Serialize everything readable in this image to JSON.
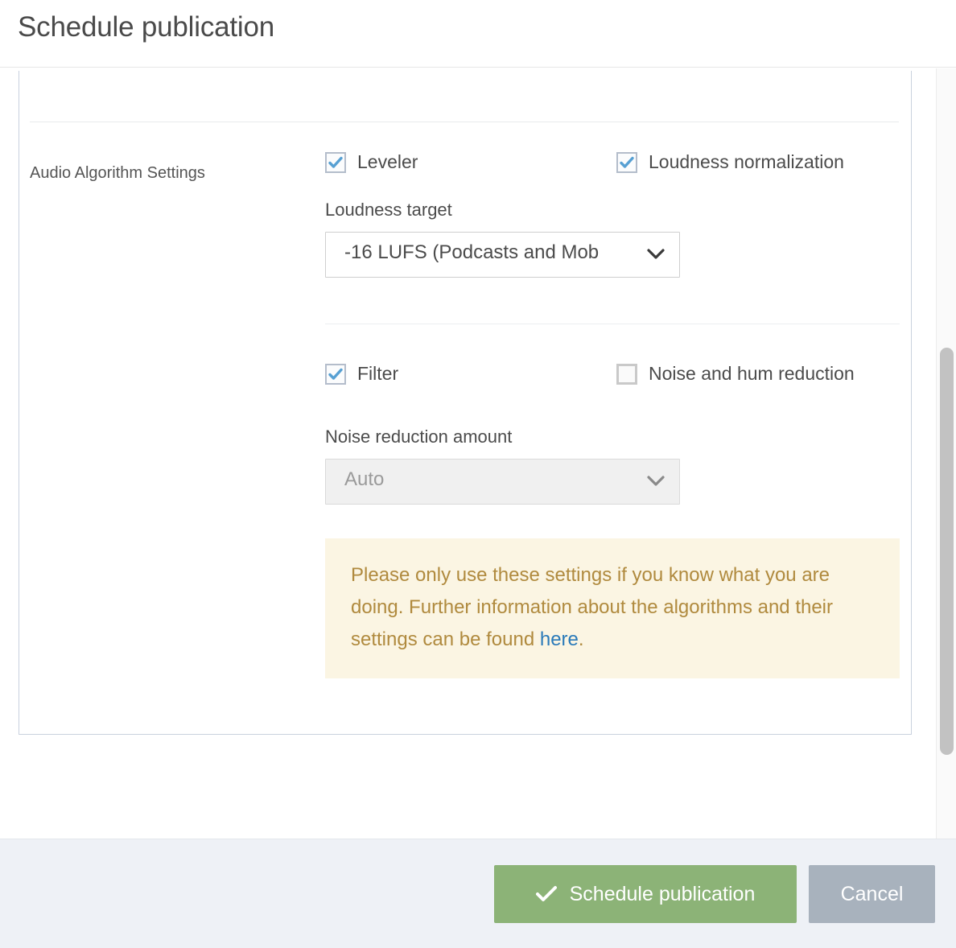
{
  "dialog": {
    "title": "Schedule publication"
  },
  "form": {
    "row_label": "Audio Algorithm Settings",
    "checkboxes": {
      "leveler": {
        "label": "Leveler",
        "checked": true
      },
      "loudness_normalization": {
        "label": "Loudness normalization",
        "checked": true
      },
      "filter": {
        "label": "Filter",
        "checked": true
      },
      "noise_and_hum_reduction": {
        "label": "Noise and hum reduction",
        "checked": false
      }
    },
    "loudness_target": {
      "label": "Loudness target",
      "value": "-16 LUFS (Podcasts and Mob",
      "disabled": false
    },
    "noise_reduction_amount": {
      "label": "Noise reduction amount",
      "value": "Auto",
      "disabled": true
    },
    "notice": {
      "text_before_link": "Please only use these settings if you know what you are doing. Further information about the algorithms and their settings can be found ",
      "link_text": "here",
      "text_after_link": "."
    }
  },
  "footer": {
    "primary_button": "Schedule publication",
    "secondary_button": "Cancel"
  },
  "colors": {
    "primary_button": "#8cb377",
    "secondary_button": "#a8b2bd",
    "notice_background": "#fbf5e3",
    "notice_text": "#b08a3e",
    "link": "#2a7ab9",
    "checkbox_check": "#57a0d3",
    "footer_background": "#eef1f6"
  }
}
